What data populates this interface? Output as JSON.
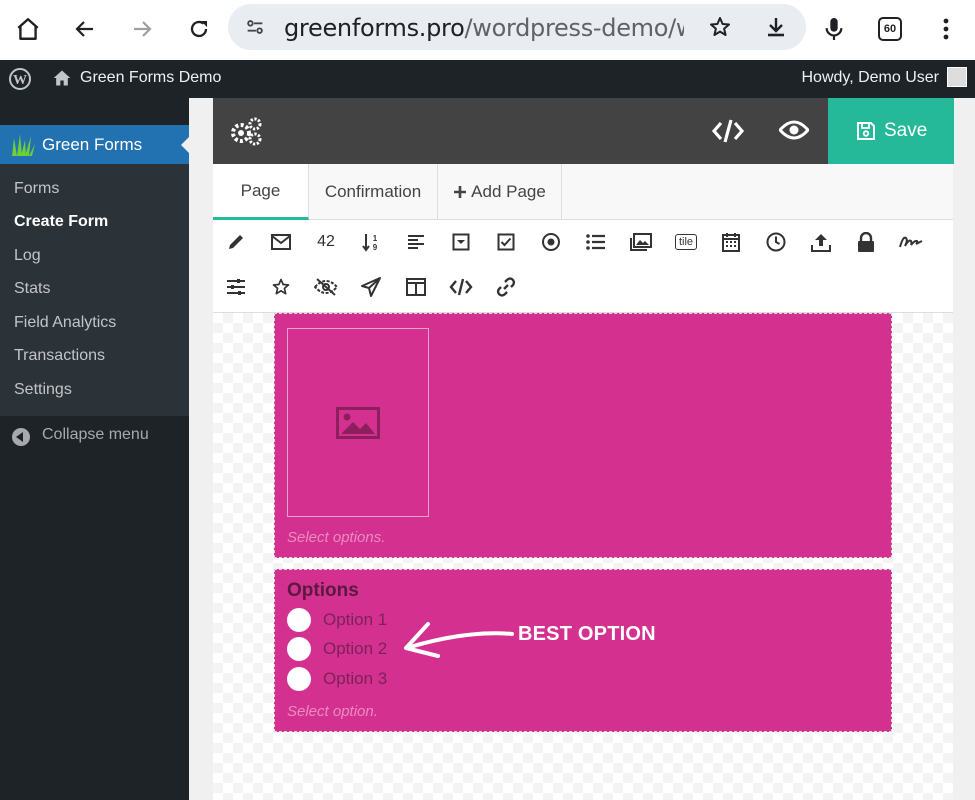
{
  "browser": {
    "url_host": "greenforms.pro",
    "url_path": "/wordpress-demo/wp-",
    "tab_count": "60"
  },
  "adminbar": {
    "site_name": "Green Forms Demo",
    "greeting": "Howdy, Demo User"
  },
  "sidebar": {
    "plugin_title": "Green Forms",
    "items": [
      {
        "label": "Forms"
      },
      {
        "label": "Create Form"
      },
      {
        "label": "Log"
      },
      {
        "label": "Stats"
      },
      {
        "label": "Field Analytics"
      },
      {
        "label": "Transactions"
      },
      {
        "label": "Settings"
      }
    ],
    "collapse_label": "Collapse menu"
  },
  "toolbar": {
    "save_label": "Save"
  },
  "tabs": [
    {
      "label": "Page"
    },
    {
      "label": "Confirmation"
    },
    {
      "label": "Add Page"
    }
  ],
  "fields_bar": {
    "number_label": "42",
    "tile_label": "tile"
  },
  "form": {
    "image_hint": "Select options.",
    "options_title": "Options",
    "options": [
      {
        "label": "Option 1"
      },
      {
        "label": "Option 2"
      },
      {
        "label": "Option 3"
      }
    ],
    "options_hint": "Select option.",
    "annotation": "BEST OPTION"
  },
  "colors": {
    "accent": "#25b99a",
    "block": "#d3308f",
    "wp_blue": "#2271b1",
    "admin_dark": "#1d2327"
  }
}
